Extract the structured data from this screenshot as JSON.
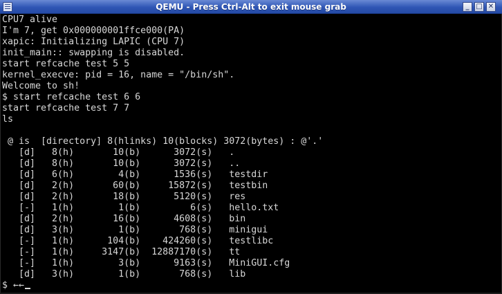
{
  "window": {
    "title": "QEMU - Press Ctrl-Alt to exit mouse grab",
    "minimize_glyph": "_",
    "maximize_glyph": "□",
    "close_glyph": "✕"
  },
  "terminal": {
    "lines": [
      "CPU7 alive",
      "I'm 7, get 0x000000001ffce000(PA)",
      "xapic: Initializing LAPIC (CPU 7)",
      "init_main:: swapping is disabled.",
      "start refcache test 5 5",
      "kernel_execve: pid = 16, name = \"/bin/sh\".",
      "Welcome to sh!",
      "$ start refcache test 6 6",
      "start refcache test 7 7",
      "ls",
      "",
      " @ is  [directory] 8(hlinks) 10(blocks) 3072(bytes) : @'.'",
      "   [d]   8(h)       10(b)      3072(s)   .",
      "   [d]   8(h)       10(b)      3072(s)   ..",
      "   [d]   6(h)        4(b)      1536(s)   testdir",
      "   [d]   2(h)       60(b)     15872(s)   testbin",
      "   [d]   2(h)       18(b)      5120(s)   res",
      "   [-]   1(h)        1(b)         6(s)   hello.txt",
      "   [d]   2(h)       16(b)      4608(s)   bin",
      "   [d]   3(h)        1(b)       768(s)   minigui",
      "   [-]   1(h)      104(b)    424260(s)   testlibc",
      "   [-]   1(h)     3147(b)  12887170(s)   tt",
      "   [-]   1(h)        3(b)      9163(s)   MiniGUI.cfg",
      "   [d]   3(h)        1(b)       768(s)   lib"
    ],
    "prompt": "$ ←←"
  },
  "colors": {
    "background": "#000000",
    "foreground": "#d8d8d8",
    "titlebar": "#2f56b5"
  }
}
